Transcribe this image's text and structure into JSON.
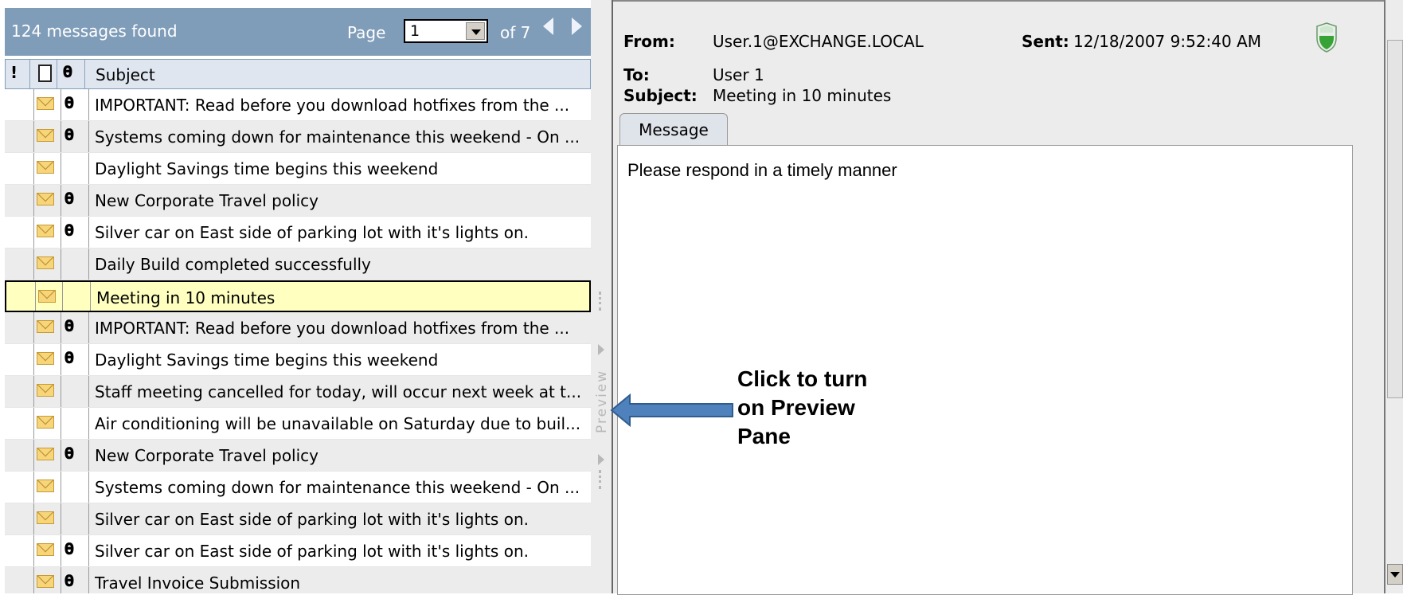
{
  "list": {
    "count_text": "124 messages found",
    "page_label": "Page",
    "page_value": "1",
    "page_of": "of 7",
    "columns": {
      "importance": "!",
      "subject": "Subject"
    },
    "rows": [
      {
        "subject": "IMPORTANT: Read before you download hotfixes from the ...",
        "attachment": true,
        "selected": false
      },
      {
        "subject": "Systems coming down for maintenance this weekend - On ...",
        "attachment": true,
        "selected": false
      },
      {
        "subject": "Daylight Savings time begins this weekend",
        "attachment": false,
        "selected": false
      },
      {
        "subject": "New Corporate Travel policy",
        "attachment": true,
        "selected": false
      },
      {
        "subject": "Silver car on East side of parking lot with it's lights on.",
        "attachment": true,
        "selected": false
      },
      {
        "subject": "Daily Build completed successfully",
        "attachment": false,
        "selected": false
      },
      {
        "subject": "Meeting in 10 minutes",
        "attachment": false,
        "selected": true
      },
      {
        "subject": "IMPORTANT: Read before you download hotfixes from the ...",
        "attachment": true,
        "selected": false
      },
      {
        "subject": "Daylight Savings time begins this weekend",
        "attachment": true,
        "selected": false
      },
      {
        "subject": "Staff meeting cancelled for today, will occur next week at t...",
        "attachment": false,
        "selected": false
      },
      {
        "subject": "Air conditioning will be unavailable on Saturday due to buil...",
        "attachment": false,
        "selected": false
      },
      {
        "subject": "New Corporate Travel policy",
        "attachment": true,
        "selected": false
      },
      {
        "subject": "Systems coming down for maintenance this weekend - On ...",
        "attachment": false,
        "selected": false
      },
      {
        "subject": "Silver car on East side of parking lot with it's lights on.",
        "attachment": false,
        "selected": false
      },
      {
        "subject": "Silver car on East side of parking lot with it's lights on.",
        "attachment": true,
        "selected": false
      },
      {
        "subject": "Travel Invoice Submission",
        "attachment": true,
        "selected": false
      }
    ]
  },
  "splitter": {
    "label": "Preview"
  },
  "preview": {
    "from_label": "From:",
    "from_value": "User.1@EXCHANGE.LOCAL",
    "sent_label": "Sent:",
    "sent_value": "12/18/2007 9:52:40 AM",
    "to_label": "To:",
    "to_value": "User 1",
    "subject_label": "Subject:",
    "subject_value": "Meeting in 10 minutes",
    "tab_label": "Message",
    "body": "Please respond in a timely manner"
  },
  "callout": {
    "text": "Click to turn\non Preview\nPane"
  },
  "icons": {
    "envelope": "envelope-icon",
    "attachment": "paperclip-icon",
    "security": "shield-icon",
    "callout_arrow": "arrow-left-icon"
  },
  "colors": {
    "header_bar": "#7f9db9",
    "selected_row": "#ffffc0",
    "arrow_fill": "#4f81bd"
  }
}
